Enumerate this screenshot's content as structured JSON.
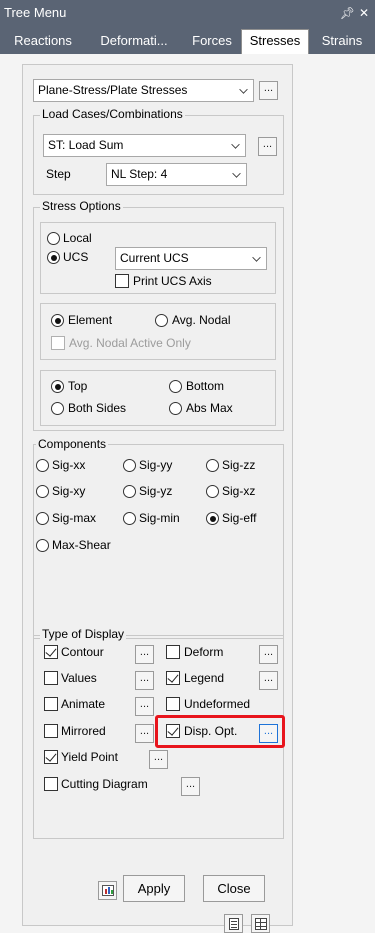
{
  "window": {
    "title": "Tree Menu",
    "pin_glyph": "↑",
    "close_glyph": "×"
  },
  "tabs": [
    {
      "label": "Reactions",
      "active": false
    },
    {
      "label": "Deformati...",
      "active": false
    },
    {
      "label": "Forces",
      "active": false
    },
    {
      "label": "Stresses",
      "active": true
    },
    {
      "label": "Strains",
      "active": false
    }
  ],
  "stress_type": {
    "selected": "Plane-Stress/Plate Stresses",
    "more_label": "..."
  },
  "load_cases": {
    "legend": "Load Cases/Combinations",
    "selected": "ST: Load Sum",
    "more_label": "...",
    "step_label": "Step",
    "step_value": "NL Step: 4"
  },
  "stress_options": {
    "legend": "Stress Options",
    "coord": {
      "local_label": "Local",
      "ucs_label": "UCS",
      "selected": "UCS",
      "ucs_combo_value": "Current UCS",
      "print_ucs_label": "Print UCS Axis",
      "print_ucs_checked": false
    },
    "nodal": {
      "element_label": "Element",
      "avg_nodal_label": "Avg. Nodal",
      "selected": "Element",
      "avg_nodal_active_label": "Avg. Nodal Active Only",
      "avg_nodal_active_enabled": false
    },
    "surface": {
      "top_label": "Top",
      "bottom_label": "Bottom",
      "both_label": "Both Sides",
      "absmax_label": "Abs Max",
      "selected": "Top"
    }
  },
  "components": {
    "legend": "Components",
    "items": [
      {
        "label": "Sig-xx",
        "selected": false
      },
      {
        "label": "Sig-yy",
        "selected": false
      },
      {
        "label": "Sig-zz",
        "selected": false
      },
      {
        "label": "Sig-xy",
        "selected": false
      },
      {
        "label": "Sig-yz",
        "selected": false
      },
      {
        "label": "Sig-xz",
        "selected": false
      },
      {
        "label": "Sig-max",
        "selected": false
      },
      {
        "label": "Sig-min",
        "selected": false
      },
      {
        "label": "Sig-eff",
        "selected": true
      },
      {
        "label": "Max-Shear",
        "selected": false
      }
    ]
  },
  "display": {
    "legend": "Type of Display",
    "more_label": "...",
    "contour": {
      "label": "Contour",
      "checked": true
    },
    "deform": {
      "label": "Deform",
      "checked": false
    },
    "values": {
      "label": "Values",
      "checked": false
    },
    "legend_opt": {
      "label": "Legend",
      "checked": true
    },
    "animate": {
      "label": "Animate",
      "checked": false
    },
    "undeformed": {
      "label": "Undeformed",
      "checked": false
    },
    "mirrored": {
      "label": "Mirrored",
      "checked": false
    },
    "disp_opt": {
      "label": "Disp. Opt.",
      "checked": true
    },
    "yield_point": {
      "label": "Yield Point",
      "checked": true
    },
    "cutting": {
      "label": "Cutting Diagram",
      "checked": false
    }
  },
  "footer": {
    "apply_label": "Apply",
    "close_label": "Close"
  },
  "colors": {
    "titlebar": "#5a6474",
    "highlight": "#e8141c",
    "dots_active": "#1e73d8"
  }
}
